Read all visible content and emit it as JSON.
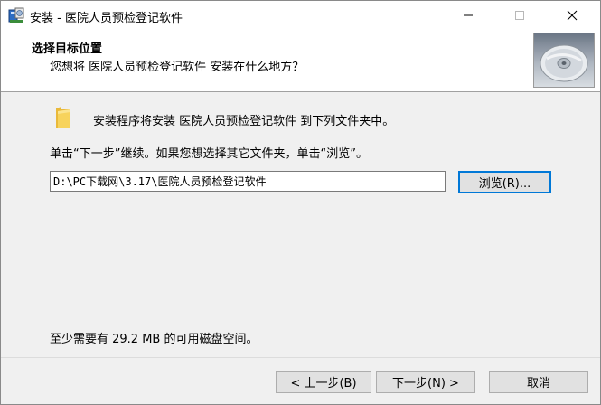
{
  "window": {
    "title": "安装 - 医院人员预检登记软件",
    "icon": "installer-app-icon",
    "controls": {
      "minimize": "minimize-icon",
      "maximize": "maximize-icon",
      "close": "close-icon"
    }
  },
  "header": {
    "title": "选择目标位置",
    "subtitle": "您想将 医院人员预检登记软件 安装在什么地方？",
    "image": "cd-disc-icon"
  },
  "body": {
    "intro": "安装程序将安装 医院人员预检登记软件 到下列文件夹中。",
    "instruction": "单击“下一步”继续。如果您想选择其它文件夹，单击“浏览”。",
    "path_value": "D:\\PC下载网\\3.17\\医院人员预检登记软件",
    "browse_label": "浏览(R)...",
    "disk_space": "至少需要有 29.2 MB 的可用磁盘空间。"
  },
  "footer": {
    "back_label": "< 上一步(B)",
    "next_label": "下一步(N) >",
    "cancel_label": "取消"
  },
  "colors": {
    "accent_focus": "#0078d7",
    "folder": "#f5c542"
  }
}
